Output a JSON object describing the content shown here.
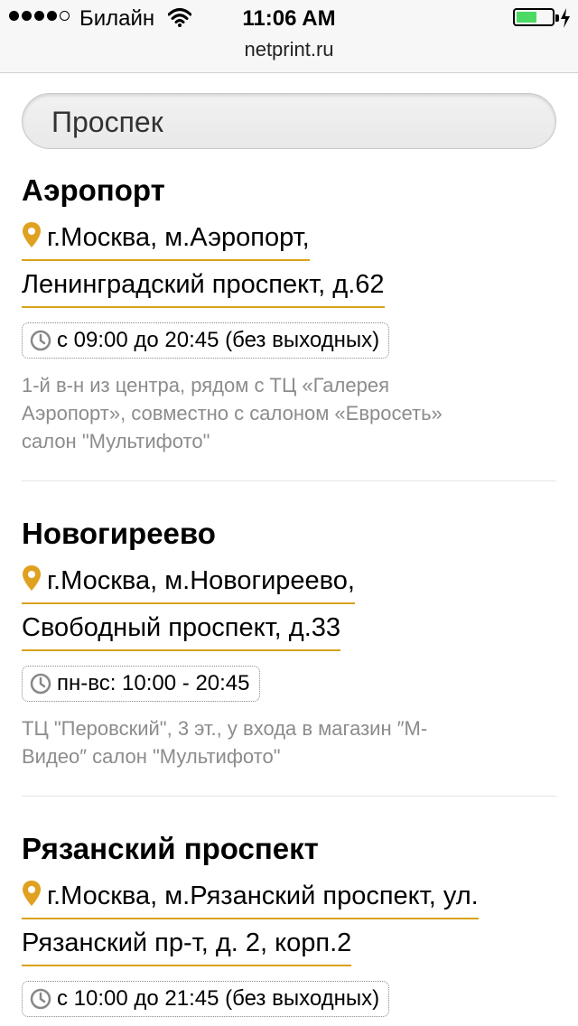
{
  "status_bar": {
    "carrier": "Билайн",
    "time": "11:06 AM",
    "battery_level": 0.85
  },
  "browser": {
    "url": "netprint.ru"
  },
  "search": {
    "value": "Проспек"
  },
  "locations": [
    {
      "title": "Аэропорт",
      "address_line1": "г.Москва, м.Аэропорт,",
      "address_line2": "Ленинградский проспект, д.62",
      "hours": "с 09:00 до 20:45 (без выходных)",
      "note_lines": [
        "1-й в-н из центра, рядом с  ТЦ «Галерея",
        "Аэропорт», совместно с салоном «Евросеть»",
        "салон \"Мультифото\""
      ]
    },
    {
      "title": "Новогиреево",
      "address_line1": "г.Москва, м.Новогиреево,",
      "address_line2": "Свободный проспект, д.33",
      "hours": "пн-вс: 10:00 - 20:45",
      "note_lines": [
        "ТЦ \"Перовский\", 3 эт., у входа в магазин ″М-",
        "Видео″ салон \"Мультифото\""
      ]
    },
    {
      "title": "Рязанский проспект",
      "address_line1": "г.Москва, м.Рязанский проспект, ул.",
      "address_line2": "Рязанский пр-т, д. 2, корп.2",
      "hours": "с 10:00 до 21:45 (без выходных)",
      "note_lines": []
    }
  ],
  "colors": {
    "accent_underline": "#d9a21b",
    "pin": "#e0a020",
    "battery": "#4cd964"
  }
}
